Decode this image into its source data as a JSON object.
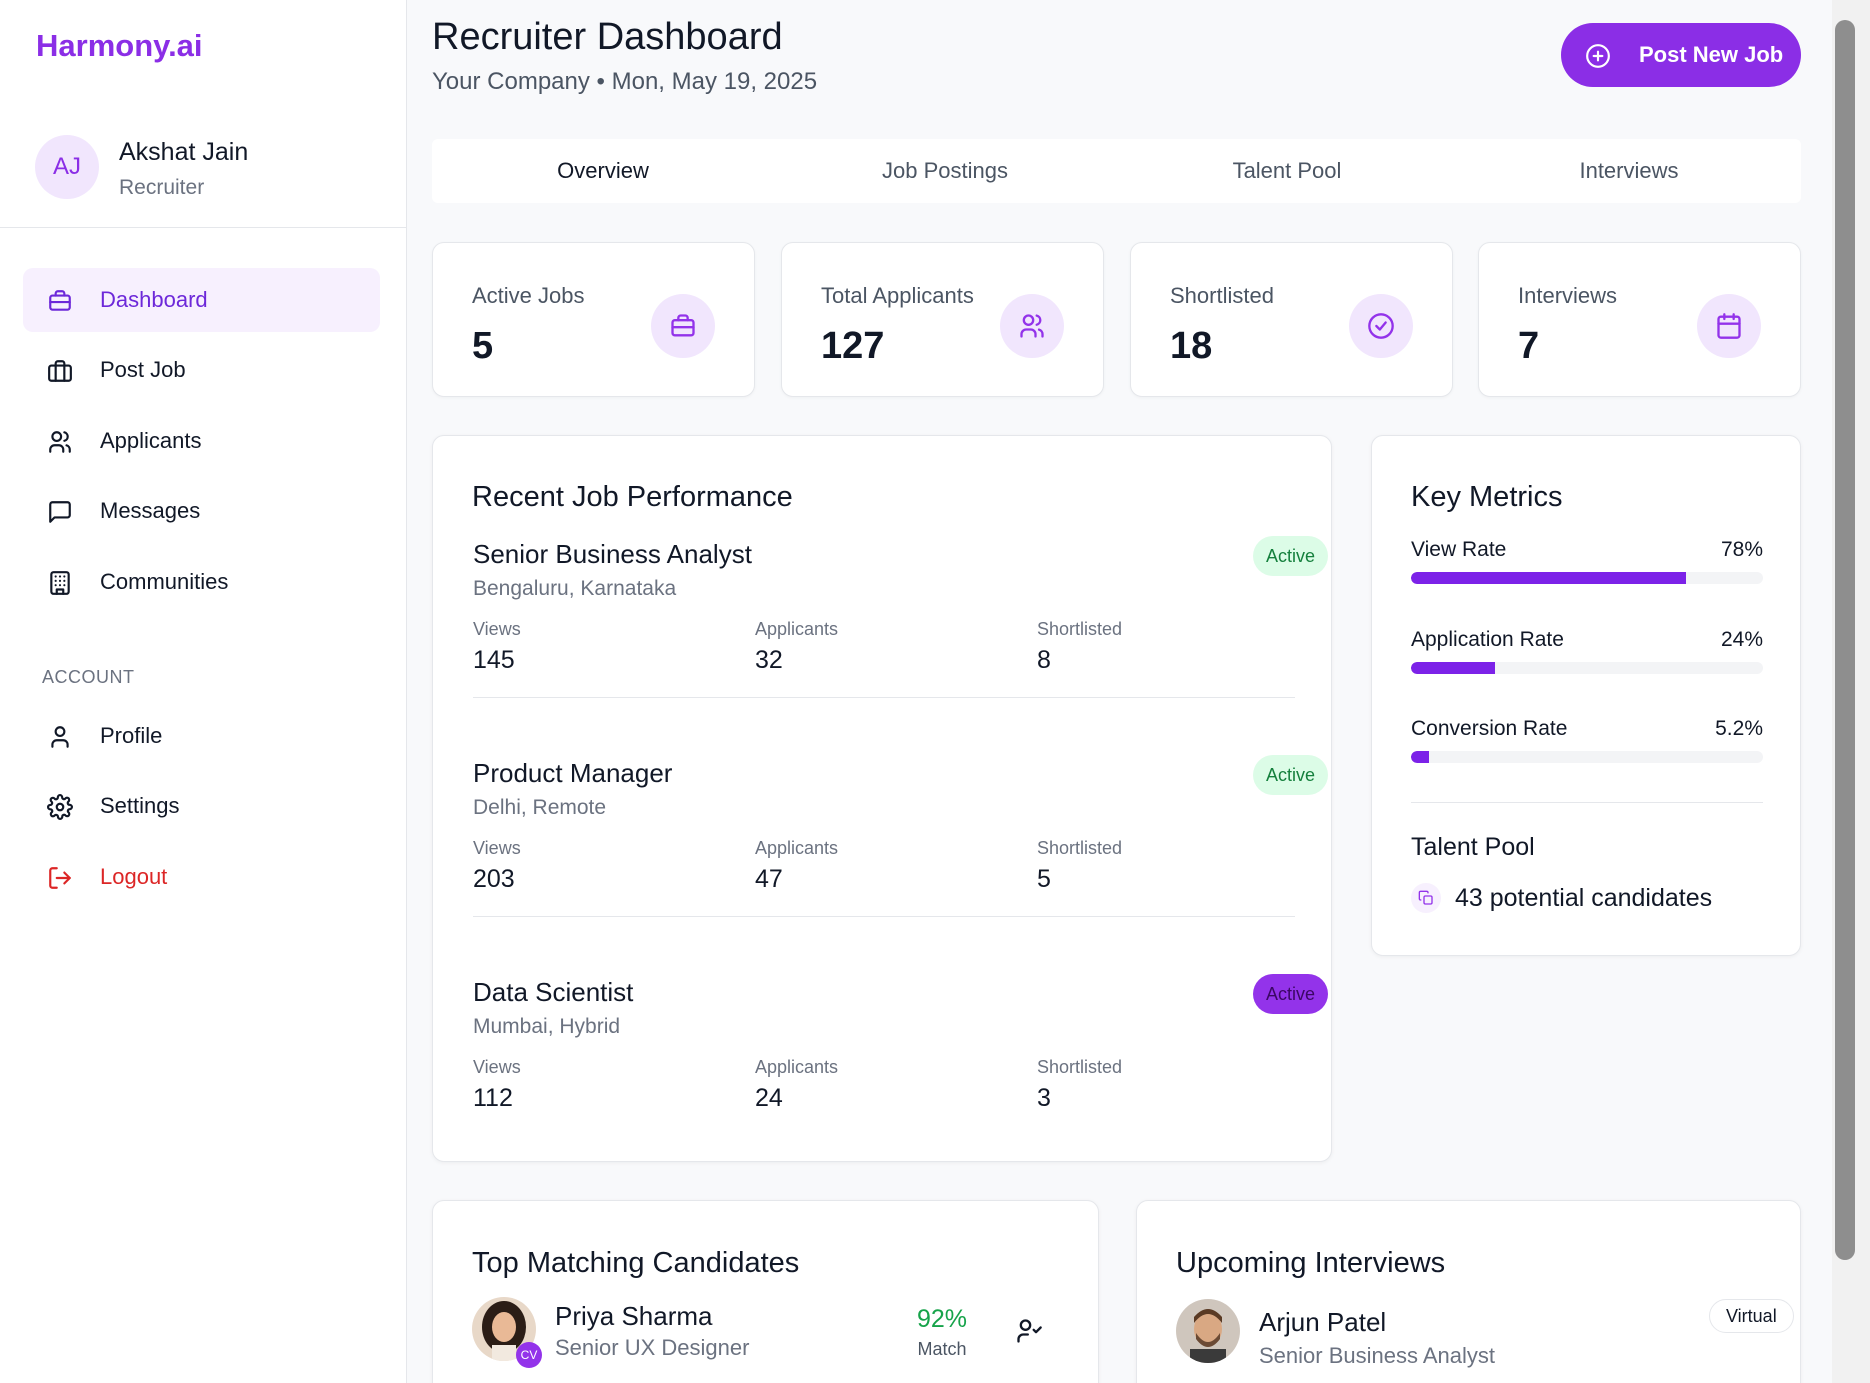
{
  "brand": "Harmony.ai",
  "user": {
    "initials": "AJ",
    "name": "Akshat Jain",
    "role": "Recruiter"
  },
  "nav": {
    "dashboard": "Dashboard",
    "post_job": "Post Job",
    "applicants": "Applicants",
    "messages": "Messages",
    "communities": "Communities",
    "account_section": "ACCOUNT",
    "profile": "Profile",
    "settings": "Settings",
    "logout": "Logout"
  },
  "header": {
    "title": "Recruiter Dashboard",
    "subtitle": "Your Company • Mon, May 19, 2025",
    "post_button": "Post New Job"
  },
  "tabs": [
    "Overview",
    "Job Postings",
    "Talent Pool",
    "Interviews"
  ],
  "stats": [
    {
      "label": "Active Jobs",
      "value": "5",
      "icon": "briefcase-icon"
    },
    {
      "label": "Total Applicants",
      "value": "127",
      "icon": "users-icon"
    },
    {
      "label": "Shortlisted",
      "value": "18",
      "icon": "check-circle-icon"
    },
    {
      "label": "Interviews",
      "value": "7",
      "icon": "calendar-icon"
    }
  ],
  "recent_jobs": {
    "title": "Recent Job Performance",
    "metric_labels": {
      "views": "Views",
      "applicants": "Applicants",
      "shortlisted": "Shortlisted"
    },
    "jobs": [
      {
        "title": "Senior Business Analyst",
        "location": "Bengaluru, Karnataka",
        "status": "Active",
        "views": "145",
        "applicants": "32",
        "shortlisted": "8"
      },
      {
        "title": "Product Manager",
        "location": "Delhi, Remote",
        "status": "Active",
        "views": "203",
        "applicants": "47",
        "shortlisted": "5"
      },
      {
        "title": "Data Scientist",
        "location": "Mumbai, Hybrid",
        "status": "Active",
        "views": "112",
        "applicants": "24",
        "shortlisted": "3"
      }
    ]
  },
  "key_metrics": {
    "title": "Key Metrics",
    "items": [
      {
        "label": "View Rate",
        "value": "78%",
        "fraction": 0.78
      },
      {
        "label": "Application Rate",
        "value": "24%",
        "fraction": 0.24
      },
      {
        "label": "Conversion Rate",
        "value": "5.2%",
        "fraction": 0.052
      }
    ],
    "talent_pool_title": "Talent Pool",
    "talent_pool_text": "43 potential candidates"
  },
  "top_candidates": {
    "title": "Top Matching Candidates",
    "candidates": [
      {
        "name": "Priya Sharma",
        "role": "Senior UX Designer",
        "badge": "CV",
        "match": "92%",
        "match_label": "Match"
      }
    ]
  },
  "upcoming_interviews": {
    "title": "Upcoming Interviews",
    "items": [
      {
        "name": "Arjun Patel",
        "role": "Senior Business Analyst",
        "type": "Virtual"
      }
    ]
  },
  "colors": {
    "accent": "#8b2ee6",
    "active_green": "#15803d",
    "danger": "#dc2626"
  }
}
